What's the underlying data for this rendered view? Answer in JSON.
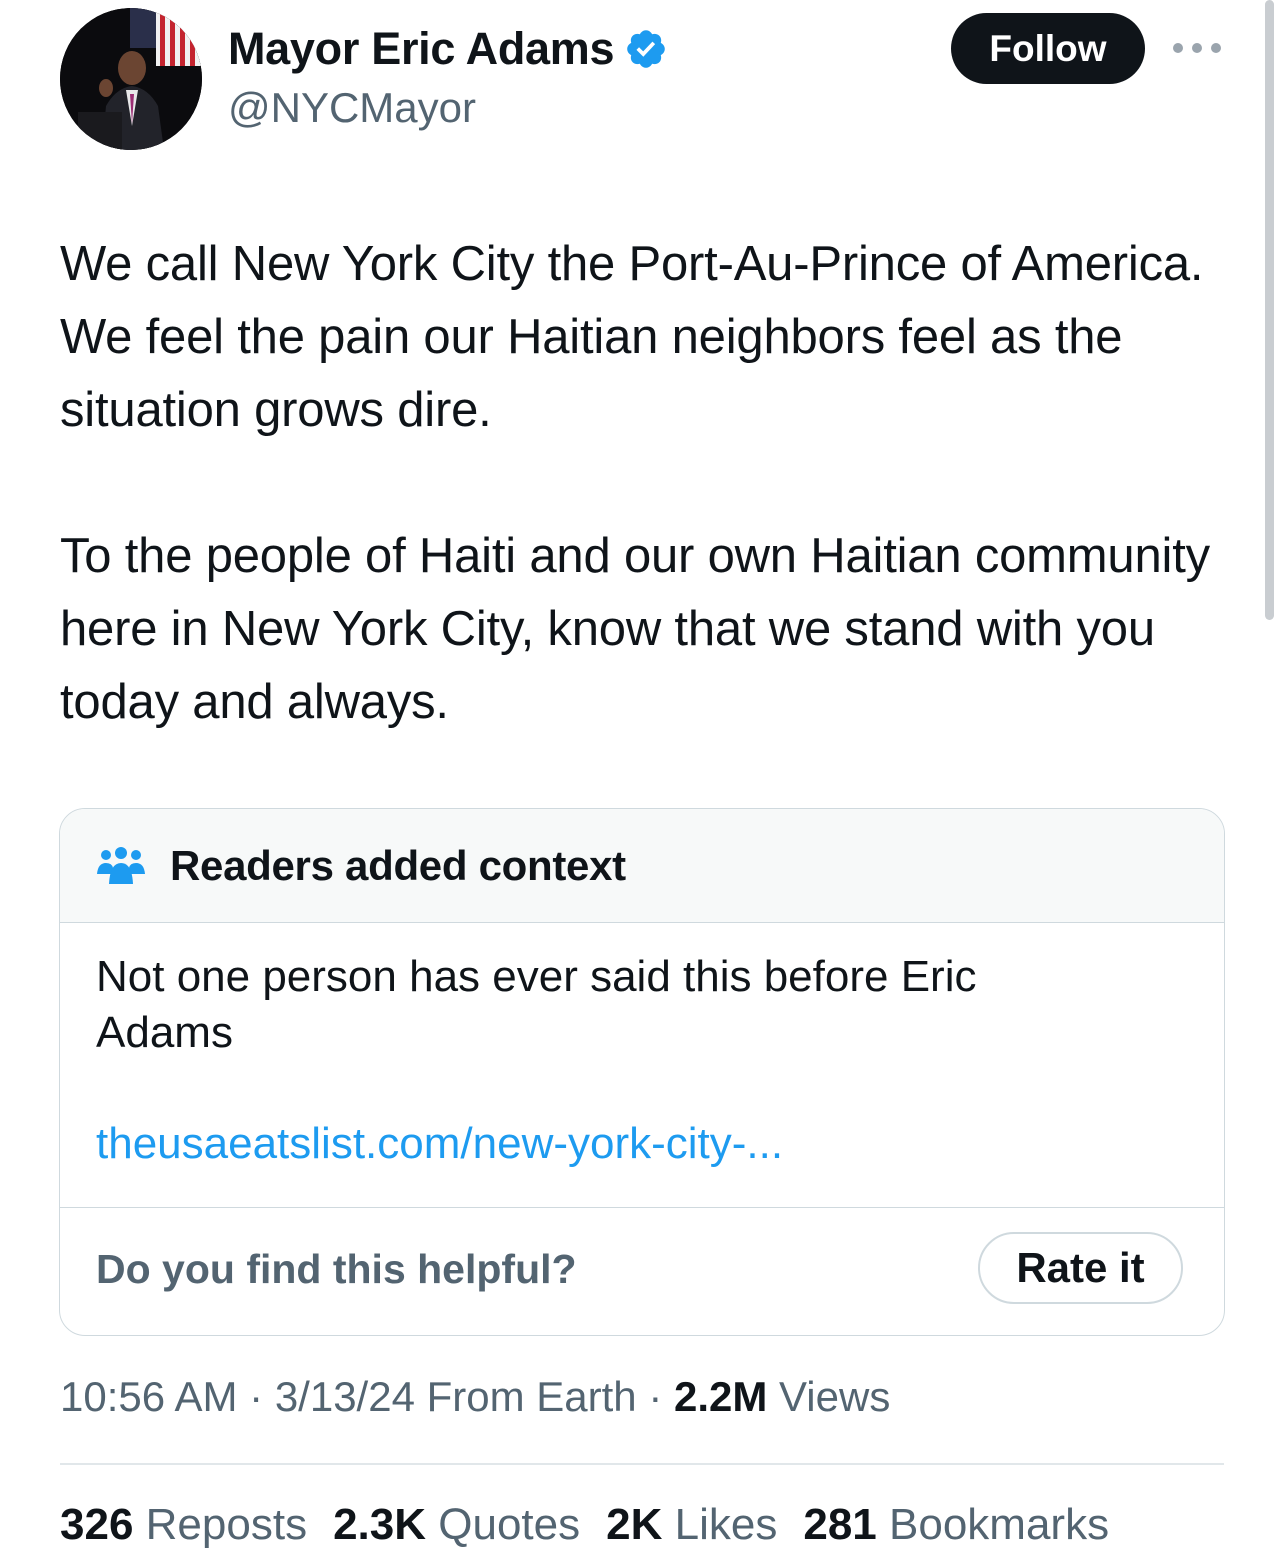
{
  "tweet": {
    "author": {
      "name": "Mayor Eric Adams",
      "handle": "@NYCMayor",
      "verified": true,
      "verified_color": "#1d9bf0"
    },
    "follow_label": "Follow",
    "text": "We call New York City the Port-Au-Prince of America. We feel the pain our Haitian neighbors feel as the situation grows dire.\n\nTo the people of Haiti and our own Haitian community here in New York City, know that we stand with you today and always.",
    "community_note": {
      "title": "Readers added context",
      "text": "Not one person has ever said this before Eric Adams",
      "link": "theusaeatslist.com/new-york-city-...",
      "question": "Do you find this helpful?",
      "rate_label": "Rate it",
      "accent_color": "#1d9bf0"
    },
    "meta": {
      "time": "10:56 AM",
      "separator": "·",
      "date_source": "3/13/24 From Earth",
      "views_count": "2.2M",
      "views_label": "Views"
    },
    "stats": [
      {
        "count": "326",
        "label": "Reposts"
      },
      {
        "count": "2.3K",
        "label": "Quotes"
      },
      {
        "count": "2K",
        "label": "Likes"
      },
      {
        "count": "281",
        "label": "Bookmarks"
      }
    ]
  },
  "icons": {
    "avatar": "avatar-photo",
    "verified": "verified-badge-icon",
    "more": "more-options-icon",
    "community": "people-icon"
  }
}
